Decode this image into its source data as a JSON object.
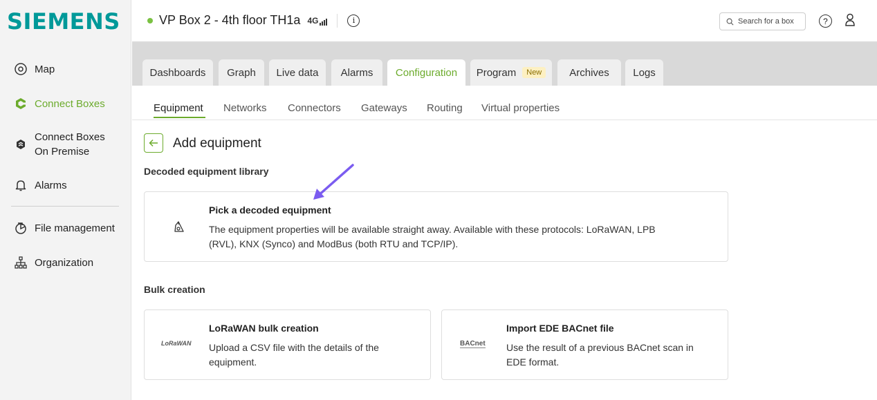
{
  "brand": "SIEMENS",
  "colors": {
    "brand": "#009999",
    "accent": "#6cab2c",
    "status_online": "#7ac142",
    "annotation_arrow": "#7b5cf0"
  },
  "sidebar": {
    "items": [
      {
        "label": "Map",
        "icon": "map-pin-icon"
      },
      {
        "label": "Connect Boxes",
        "icon": "connect-boxes-icon",
        "active": true
      },
      {
        "label_line1": "Connect Boxes",
        "label_line2": "On Premise",
        "icon": "on-premise-icon"
      },
      {
        "label": "Alarms",
        "icon": "bell-icon"
      },
      {
        "label": "File management",
        "icon": "file-management-icon"
      },
      {
        "label": "Organization",
        "icon": "organization-icon"
      }
    ]
  },
  "header": {
    "title": "VP Box 2 - 4th floor TH1a",
    "signal_label": "4G",
    "search_placeholder": "Search for a box"
  },
  "tabs": [
    {
      "label": "Dashboards"
    },
    {
      "label": "Graph"
    },
    {
      "label": "Live data"
    },
    {
      "label": "Alarms"
    },
    {
      "label": "Configuration",
      "active": true
    },
    {
      "label": "Program",
      "badge": "New"
    },
    {
      "label": "Archives"
    },
    {
      "label": "Logs"
    }
  ],
  "subtabs": [
    {
      "label": "Equipment",
      "active": true
    },
    {
      "label": "Networks"
    },
    {
      "label": "Connectors"
    },
    {
      "label": "Gateways"
    },
    {
      "label": "Routing"
    },
    {
      "label": "Virtual properties"
    }
  ],
  "page": {
    "title": "Add equipment",
    "library_section": "Decoded equipment library",
    "bulk_section": "Bulk creation"
  },
  "cards": {
    "decoded": {
      "title": "Pick a decoded equipment",
      "desc_line1": "The equipment properties will be available straight away. Available with these protocols: LoRaWAN, LPB",
      "desc_line2": "(RVL), KNX (Synco) and ModBus (both RTU and TCP/IP)."
    },
    "lorawan": {
      "logo_text": "LoRaWAN",
      "title": "LoRaWAN bulk creation",
      "desc_line1": "Upload a CSV file with the details of the",
      "desc_line2": "equipment."
    },
    "bacnet": {
      "logo_text": "BACnet",
      "title": "Import EDE BACnet file",
      "desc_line1": "Use the result of a previous BACnet scan in",
      "desc_line2": "EDE format."
    }
  }
}
